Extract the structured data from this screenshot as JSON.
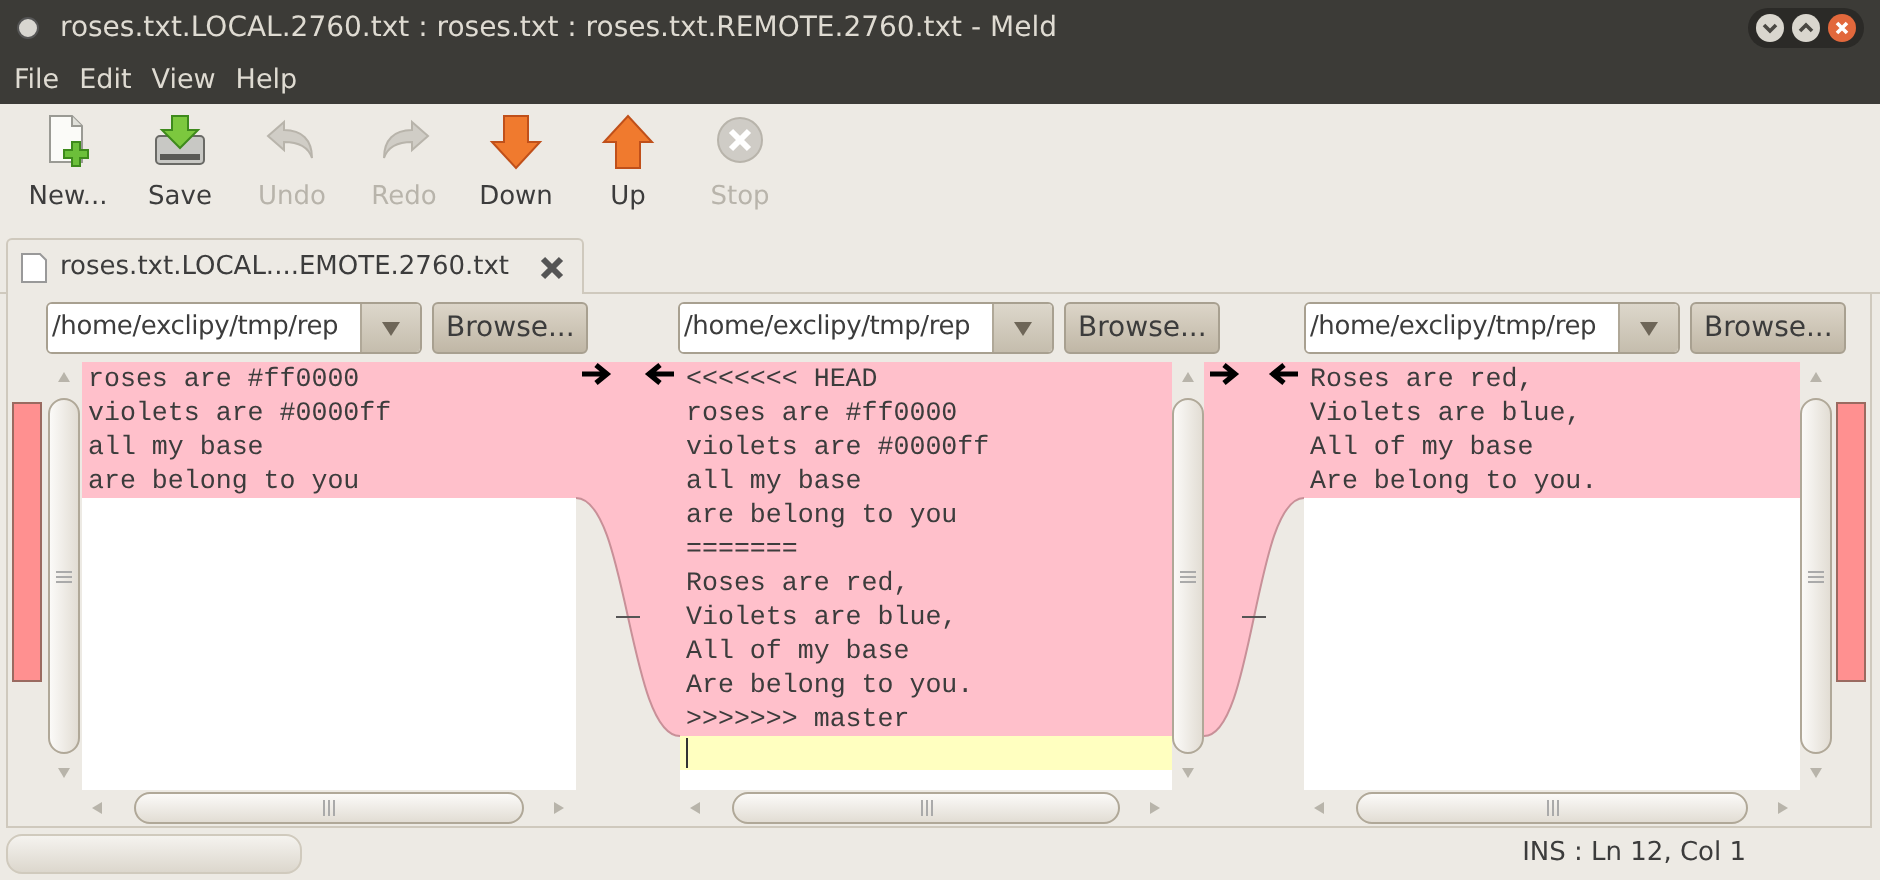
{
  "window": {
    "title": "roses.txt.LOCAL.2760.txt : roses.txt : roses.txt.REMOTE.2760.txt - Meld"
  },
  "menu": [
    "File",
    "Edit",
    "View",
    "Help"
  ],
  "toolbar": [
    {
      "label": "New...",
      "kind": "new",
      "disabled": false
    },
    {
      "label": "Save",
      "kind": "save",
      "disabled": false
    },
    {
      "label": "Undo",
      "kind": "undo",
      "disabled": true
    },
    {
      "label": "Redo",
      "kind": "redo",
      "disabled": true
    },
    {
      "label": "Down",
      "kind": "down",
      "disabled": false
    },
    {
      "label": "Up",
      "kind": "up",
      "disabled": false
    },
    {
      "label": "Stop",
      "kind": "stop",
      "disabled": true
    }
  ],
  "tabs": [
    {
      "label": "roses.txt.LOCAL....EMOTE.2760.txt",
      "selected": true
    }
  ],
  "panes": [
    {
      "path": "/home/exclipy/tmp/rep",
      "browse": "Browse...",
      "lines": [
        {
          "text": "roses are #ff0000",
          "kind": "conflict"
        },
        {
          "text": "violets are #0000ff",
          "kind": "conflict"
        },
        {
          "text": "all my base",
          "kind": "conflict"
        },
        {
          "text": "are belong to you",
          "kind": "conflict"
        }
      ]
    },
    {
      "path": "/home/exclipy/tmp/rep",
      "browse": "Browse...",
      "lines": [
        {
          "text": "<<<<<<< HEAD",
          "kind": "conflict"
        },
        {
          "text": "roses are #ff0000",
          "kind": "conflict"
        },
        {
          "text": "violets are #0000ff",
          "kind": "conflict"
        },
        {
          "text": "all my base",
          "kind": "conflict"
        },
        {
          "text": "are belong to you",
          "kind": "conflict"
        },
        {
          "text": "=======",
          "kind": "conflict"
        },
        {
          "text": "Roses are red,",
          "kind": "conflict"
        },
        {
          "text": "Violets are blue,",
          "kind": "conflict"
        },
        {
          "text": "All of my base",
          "kind": "conflict"
        },
        {
          "text": "Are belong to you.",
          "kind": "conflict"
        },
        {
          "text": ">>>>>>> master",
          "kind": "conflict"
        },
        {
          "kind": "current"
        }
      ]
    },
    {
      "path": "/home/exclipy/tmp/rep",
      "browse": "Browse...",
      "lines": [
        {
          "text": "Roses are red,",
          "kind": "conflict"
        },
        {
          "text": "Violets are blue,",
          "kind": "conflict"
        },
        {
          "text": "All of my base",
          "kind": "conflict"
        },
        {
          "text": "Are belong to you.",
          "kind": "conflict"
        }
      ]
    }
  ],
  "status_bar": {
    "text": "INS : Ln 12, Col 1"
  }
}
